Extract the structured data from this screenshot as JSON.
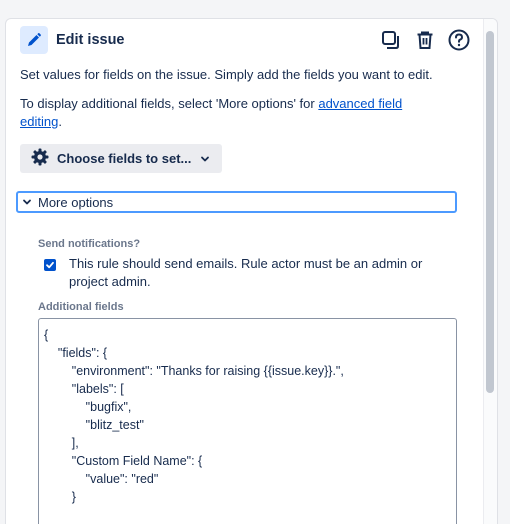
{
  "header": {
    "title": "Edit issue"
  },
  "description": {
    "line1": "Set values for fields on the issue. Simply add the fields you want to edit.",
    "line2_prefix": "To display additional fields, select 'More options' for ",
    "line2_link": "advanced field editing",
    "line2_suffix": "."
  },
  "choose_fields": {
    "label": "Choose fields to set..."
  },
  "more_options": {
    "label": "More options"
  },
  "notifications": {
    "label": "Send notifications?",
    "checkbox_text": "This rule should send emails. Rule actor must be an admin or project admin.",
    "checked": true
  },
  "additional_fields": {
    "label": "Additional fields",
    "code": "{\n    \"fields\": {\n        \"environment\": \"Thanks for raising {{issue.key}}.\",\n        \"labels\": [\n            \"bugfix\",\n            \"blitz_test\"\n        ],\n        \"Custom Field Name\": {\n            \"value\": \"red\"\n        }"
  },
  "icons": {
    "edit": "pencil-icon",
    "copy": "copy-icon",
    "delete": "trash-icon",
    "help": "help-icon",
    "settings": "gear-icon",
    "chevron": "chevron-down-icon"
  },
  "colors": {
    "accent": "#0052cc",
    "focus_border": "#4c9aff",
    "badge_bg": "#deebff"
  }
}
